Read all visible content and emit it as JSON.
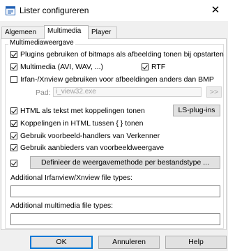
{
  "window": {
    "title": "Lister configureren",
    "close_glyph": "✕"
  },
  "tabs": [
    {
      "label": "Algemeen"
    },
    {
      "label": "Multimedia"
    },
    {
      "label": "Player"
    }
  ],
  "group": {
    "title": "Multimediaweergave"
  },
  "options": {
    "plugins_bitmaps": {
      "label": "Plugins gebruiken of bitmaps als afbeelding tonen bij opstarten",
      "checked": true
    },
    "multimedia": {
      "label": "Multimedia (AVI, WAV, ...)",
      "checked": true
    },
    "rtf": {
      "label": "RTF",
      "checked": true
    },
    "irfan": {
      "label": "Irfan-/Xnview gebruiken voor afbeeldingen anders dan BMP",
      "checked": false
    },
    "html_text": {
      "label": "HTML als tekst met koppelingen tonen",
      "checked": true
    },
    "links_braces": {
      "label": "Koppelingen in HTML tussen { } tonen",
      "checked": true
    },
    "preview_handlers": {
      "label": "Gebruik voorbeeld-handlers van Verkenner",
      "checked": true
    },
    "preview_providers": {
      "label": "Gebruik aanbieders van voorbeeldweergave",
      "checked": true
    },
    "define_method": {
      "checked": true
    }
  },
  "path": {
    "label": "Pad:",
    "value": "i_view32.exe",
    "browse_label": ">>"
  },
  "buttons": {
    "ls_plugins": "LS-plug-ins",
    "define_method": "Definieer de weergavemethode per bestandstype ...",
    "ok": "OK",
    "cancel": "Annuleren",
    "help": "Help"
  },
  "fields": {
    "irfan_types": {
      "label": "Additional Irfanview/Xnview file types:",
      "value": ""
    },
    "multimedia_types": {
      "label": "Additional multimedia file types:",
      "value": ""
    }
  },
  "colors": {
    "accent": "#0078d7",
    "app_icon_blue": "#1f5fb4"
  },
  "icons": {
    "app": "lister-app-icon",
    "close": "close-icon"
  }
}
